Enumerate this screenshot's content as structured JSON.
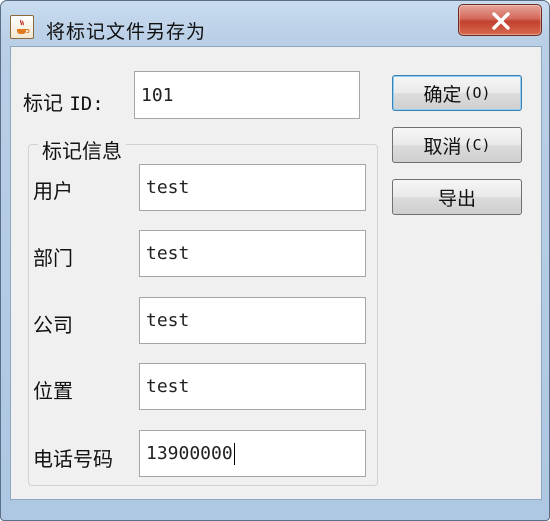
{
  "window": {
    "title": "将标记文件另存为",
    "app_icon": "java-cup-icon",
    "close_icon": "close-icon"
  },
  "form": {
    "id_label": "标记",
    "id_label_suffix": "ID:",
    "id_value": "101",
    "group_title": "标记信息",
    "fields": [
      {
        "label": "用户",
        "value": "test"
      },
      {
        "label": "部门",
        "value": "test"
      },
      {
        "label": "公司",
        "value": "test"
      },
      {
        "label": "位置",
        "value": "test"
      },
      {
        "label": "电话号码",
        "value": "13900000"
      }
    ]
  },
  "buttons": {
    "ok_label": "确定",
    "ok_mnemonic": "(O)",
    "cancel_label": "取消",
    "cancel_mnemonic": "(C)",
    "export_label": "导出"
  },
  "colors": {
    "title_bar": "#b9cfe6",
    "close_button": "#c1412f",
    "client_bg": "#f0f0f0"
  }
}
